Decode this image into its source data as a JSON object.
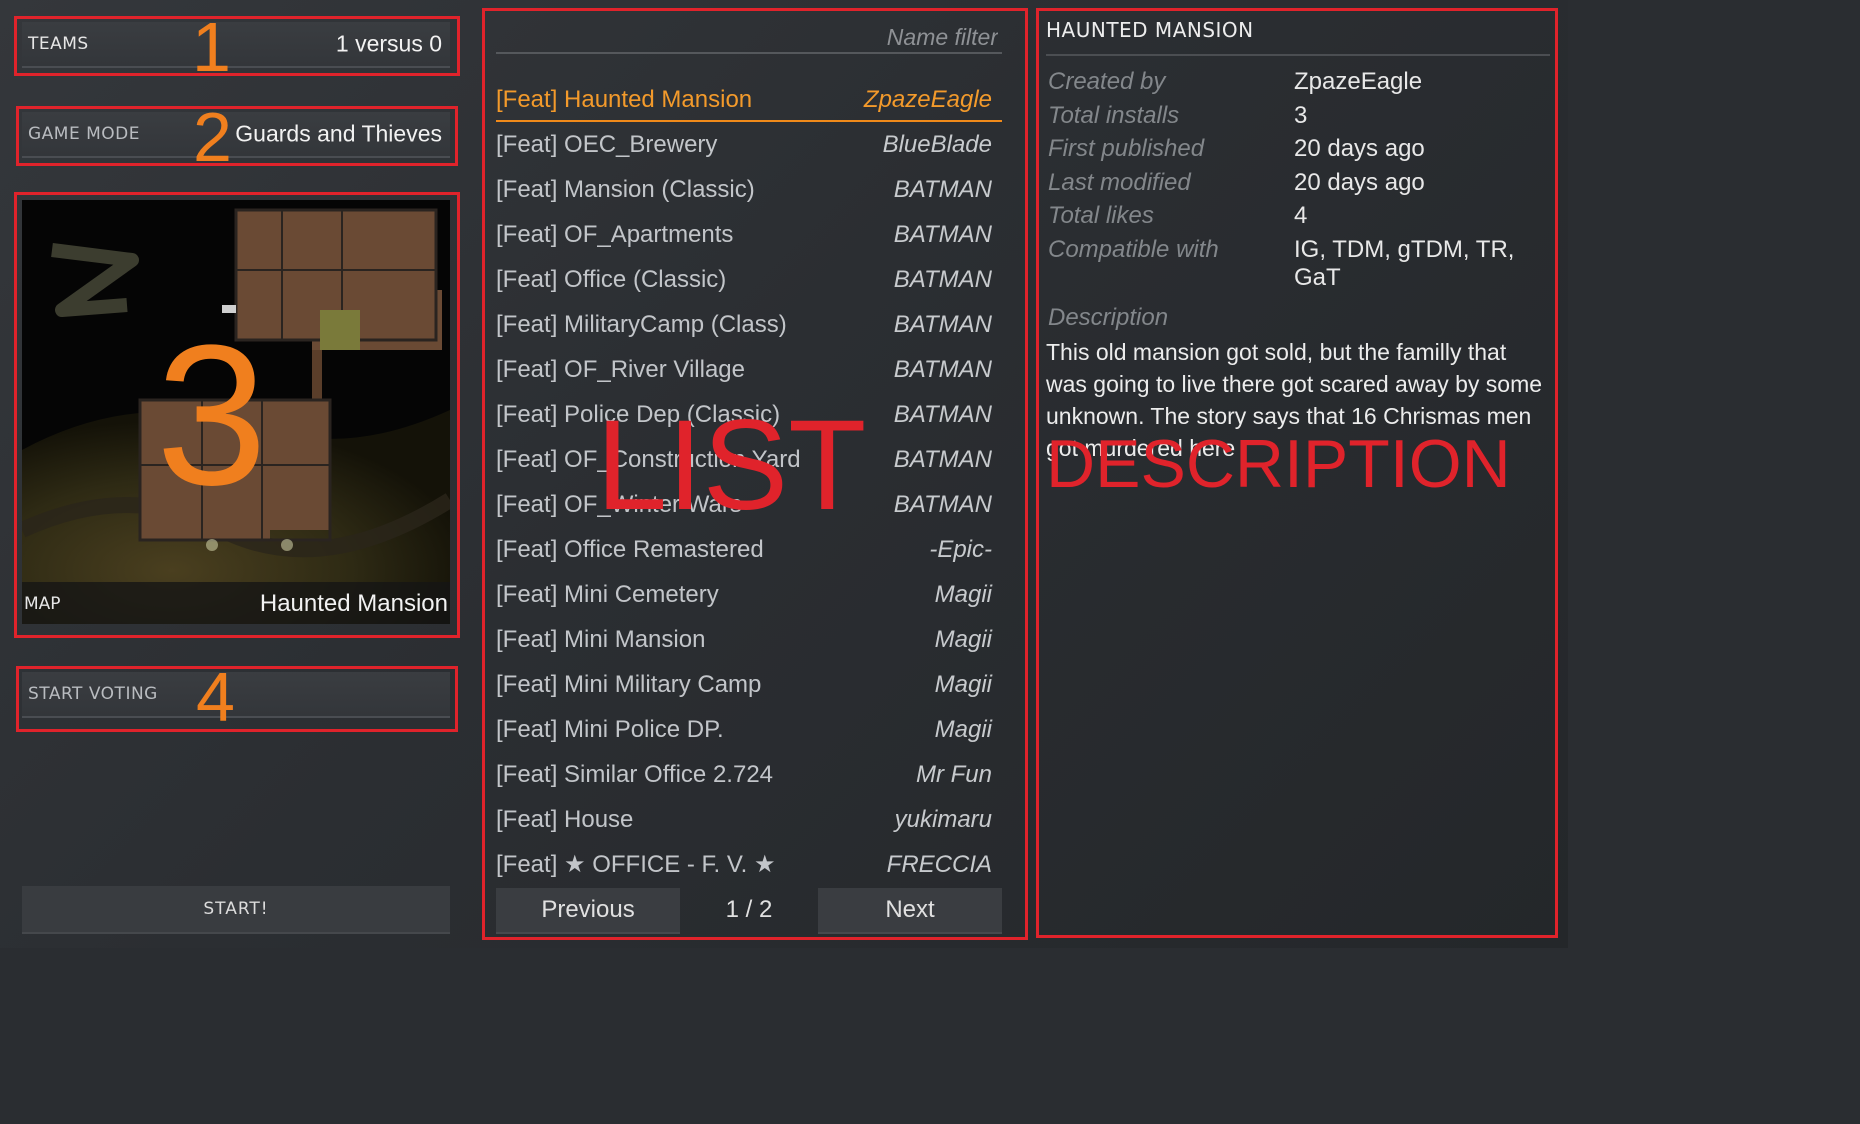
{
  "settings": {
    "teams": {
      "label": "TEAMS",
      "value": "1 versus 0"
    },
    "game_mode": {
      "label": "GAME MODE",
      "value": "Guards and Thieves"
    },
    "map": {
      "label": "MAP",
      "value": "Haunted Mansion"
    },
    "start_voting": {
      "label": "START VOTING"
    },
    "start_button": "START!"
  },
  "annotations": {
    "n1": "1",
    "n2": "2",
    "n3": "3",
    "n4": "4",
    "list": "LIST",
    "description": "DESCRIPTION",
    "color_box": "#e0232b",
    "color_num": "#f07f1e"
  },
  "list": {
    "filter_placeholder": "Name filter",
    "selected_index": 0,
    "items": [
      {
        "name": "[Feat] Haunted Mansion",
        "author": "ZpazeEagle"
      },
      {
        "name": "[Feat] OEC_Brewery",
        "author": "BlueBlade"
      },
      {
        "name": "[Feat] Mansion (Classic)",
        "author": "BATMAN"
      },
      {
        "name": "[Feat] OF_Apartments",
        "author": "BATMAN"
      },
      {
        "name": "[Feat] Office (Classic)",
        "author": "BATMAN"
      },
      {
        "name": "[Feat] MilitaryCamp (Class)",
        "author": "BATMAN"
      },
      {
        "name": "[Feat] OF_River Village",
        "author": "BATMAN"
      },
      {
        "name": "[Feat] Police Dep (Classic)",
        "author": "BATMAN"
      },
      {
        "name": "[Feat] OF_Construction Yard",
        "author": "BATMAN"
      },
      {
        "name": "[Feat] OF_Winter Wars",
        "author": "BATMAN"
      },
      {
        "name": "[Feat] Office Remastered",
        "author": "-Epic-"
      },
      {
        "name": "[Feat] Mini Cemetery",
        "author": "Magii"
      },
      {
        "name": "[Feat] Mini Mansion",
        "author": "Magii"
      },
      {
        "name": "[Feat] Mini Military Camp",
        "author": "Magii"
      },
      {
        "name": "[Feat] Mini Police DP.",
        "author": "Magii"
      },
      {
        "name": "[Feat] Similar Office 2.724",
        "author": "Mr Fun"
      },
      {
        "name": "[Feat] House",
        "author": "yukimaru"
      },
      {
        "name": "[Feat] ★ OFFICE - F. V. ★",
        "author": "FRECCIA"
      }
    ],
    "pager": {
      "previous": "Previous",
      "page": "1 / 2",
      "next": "Next"
    }
  },
  "description": {
    "title": "HAUNTED MANSION",
    "info": [
      {
        "key": "Created by",
        "value": "ZpazeEagle"
      },
      {
        "key": "Total installs",
        "value": "3"
      },
      {
        "key": "First published",
        "value": "20 days ago"
      },
      {
        "key": "Last modified",
        "value": "20 days ago"
      },
      {
        "key": "Total likes",
        "value": "4"
      },
      {
        "key": "Compatible with",
        "value": "IG, TDM, gTDM, TR, GaT"
      }
    ],
    "desc_label": "Description",
    "desc_text": "This old mansion got sold, but the familly that was going to live there got scared away by some unknown. The story says that 16 Chrismas men got murdered here"
  }
}
